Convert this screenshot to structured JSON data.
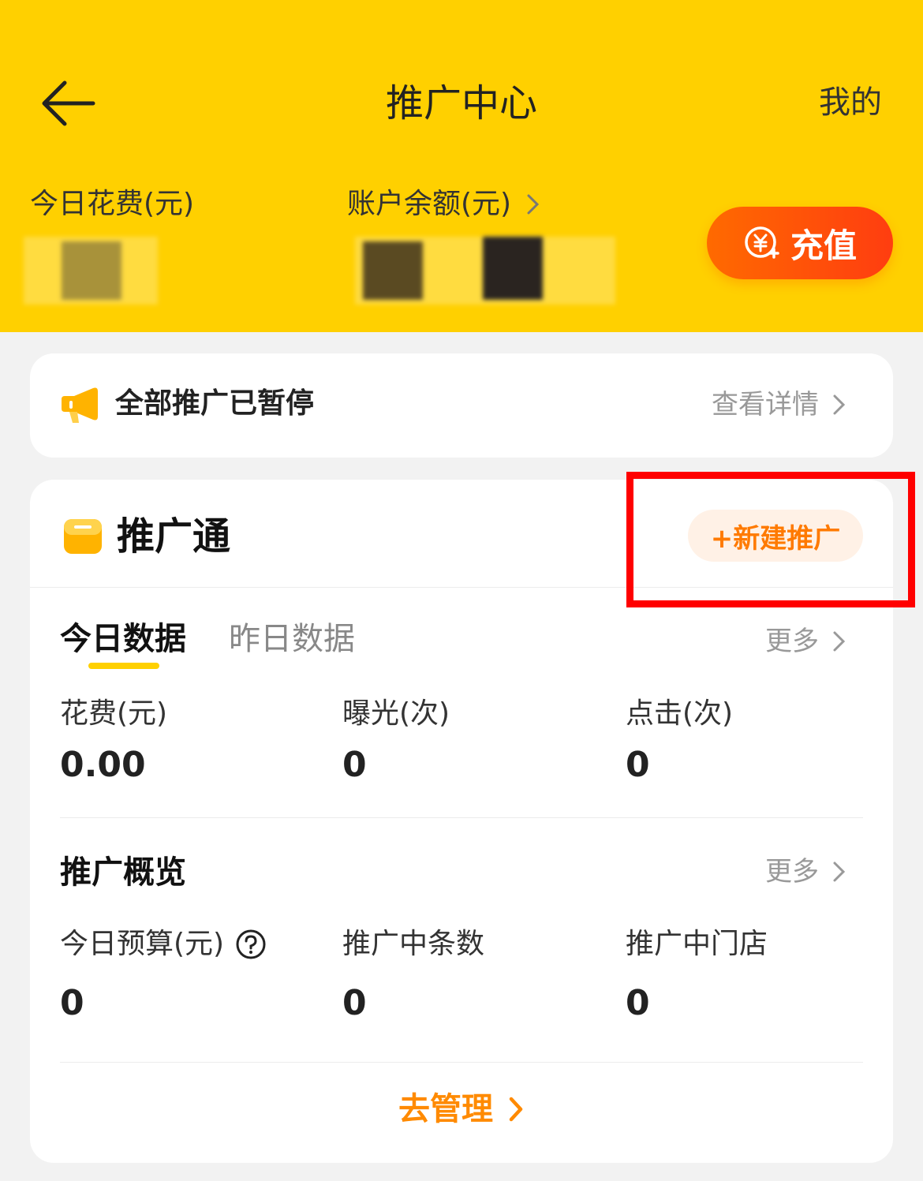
{
  "header": {
    "title": "推广中心",
    "mine_label": "我的",
    "today_spend_label": "今日花费(元)",
    "balance_label": "账户余额(元)",
    "recharge_label": "充值"
  },
  "notice": {
    "text": "全部推广已暂停",
    "detail_label": "查看详情"
  },
  "promo_card": {
    "title": "推广通",
    "new_button_label": "+新建推广",
    "tabs": [
      "今日数据",
      "昨日数据"
    ],
    "more_label": "更多",
    "metrics": [
      {
        "label": "花费(元)",
        "value": "0.00"
      },
      {
        "label": "曝光(次)",
        "value": "0"
      },
      {
        "label": "点击(次)",
        "value": "0"
      }
    ],
    "overview_title": "推广概览",
    "overview_more_label": "更多",
    "overview_metrics": [
      {
        "label": "今日预算(元)",
        "value": "0"
      },
      {
        "label": "推广中条数",
        "value": "0"
      },
      {
        "label": "推广中门店",
        "value": "0"
      }
    ],
    "manage_label": "去管理"
  },
  "colors": {
    "header_bg": "#ffd000",
    "accent_orange": "#ff7a00",
    "highlight_red": "#ff0000"
  }
}
